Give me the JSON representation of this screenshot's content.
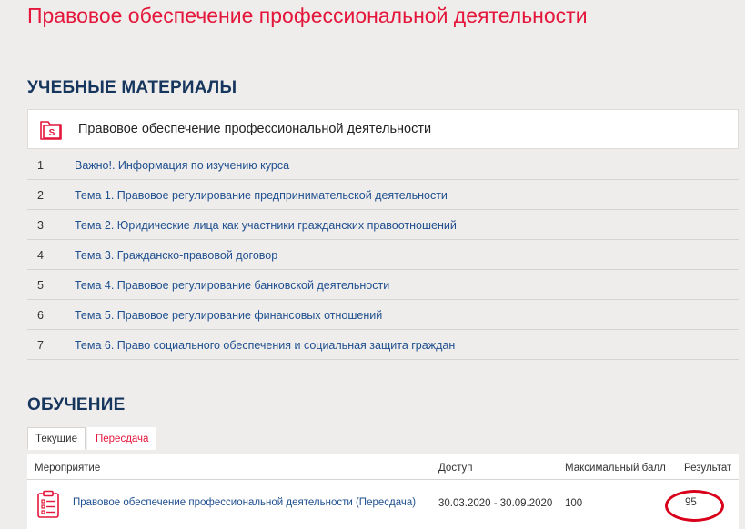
{
  "page": {
    "title": "Правовое обеспечение профессиональной деятельности"
  },
  "materials": {
    "heading": "УЧЕБНЫЕ МАТЕРИАЛЫ",
    "course": {
      "name": "Правовое обеспечение профессиональной деятельности",
      "icon": "folder-s-icon"
    },
    "topics": [
      {
        "num": "1",
        "label": "Важно!. Информация по изучению курса"
      },
      {
        "num": "2",
        "label": "Тема 1. Правовое регулирование предпринимательской деятельности"
      },
      {
        "num": "3",
        "label": "Тема 2. Юридические лица как участники гражданских правоотношений"
      },
      {
        "num": "4",
        "label": "Тема 3. Гражданско-правовой договор"
      },
      {
        "num": "5",
        "label": "Тема 4. Правовое регулирование банковской деятельности"
      },
      {
        "num": "6",
        "label": "Тема 5. Правовое регулирование финансовых отношений"
      },
      {
        "num": "7",
        "label": "Тема 6. Право социального обеспечения и социальная защита граждан"
      }
    ]
  },
  "training": {
    "heading": "ОБУЧЕНИЕ",
    "tabs": {
      "current": "Текущие",
      "retake": "Пересдача"
    },
    "columns": {
      "activity": "Мероприятие",
      "access": "Доступ",
      "max_score": "Максимальный балл",
      "result": "Результат"
    },
    "rows": [
      {
        "name": "Правовое обеспечение профессиональной деятельности (Пересдача)",
        "access": "30.03.2020 - 30.09.2020",
        "max_score": "100",
        "result": "95",
        "icon": "checklist-icon"
      }
    ]
  },
  "colors": {
    "accent_red": "#e4163b",
    "heading_navy": "#17365d",
    "link_blue": "#1f4f8f",
    "background": "#efedeb",
    "annotation_circle": "#d8001a"
  }
}
